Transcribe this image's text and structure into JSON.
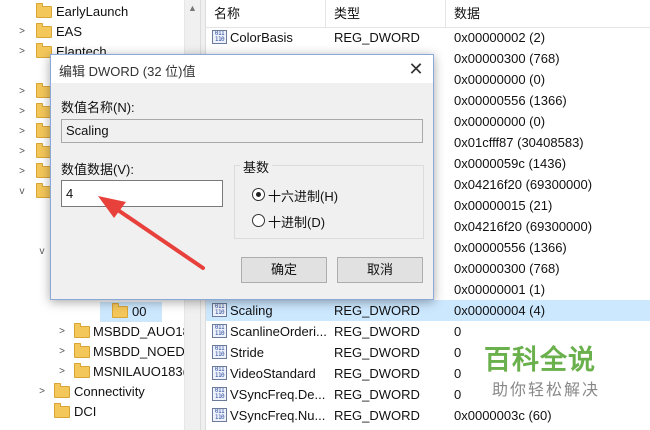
{
  "tree": {
    "items": [
      {
        "label": "EarlyLaunch"
      },
      {
        "label": "EAS"
      },
      {
        "label": "Elantech"
      },
      {
        "label": "00"
      },
      {
        "label": "MSBDD_AUO18"
      },
      {
        "label": "MSBDD_NOEDI"
      },
      {
        "label": "MSNILAUO183("
      },
      {
        "label": "Connectivity"
      },
      {
        "label": "DCI"
      }
    ]
  },
  "list": {
    "headers": {
      "name": "名称",
      "type": "类型",
      "data": "数据"
    },
    "rows": [
      {
        "name": "ColorBasis",
        "type": "REG_DWORD",
        "data": "0x00000002 (2)"
      },
      {
        "name": "",
        "type": "",
        "data": "0x00000300 (768)"
      },
      {
        "name": "",
        "type": "",
        "data": "0x00000000 (0)"
      },
      {
        "name": "",
        "type": "",
        "data": "0x00000556 (1366)"
      },
      {
        "name": "",
        "type": "",
        "data": "0x00000000 (0)"
      },
      {
        "name": "",
        "type": "",
        "data": "0x01cfff87 (30408583)"
      },
      {
        "name": "",
        "type": "",
        "data": "0x0000059c (1436)"
      },
      {
        "name": "",
        "type": "",
        "data": "0x04216f20 (69300000)"
      },
      {
        "name": "",
        "type": "",
        "data": "0x00000015 (21)"
      },
      {
        "name": "",
        "type": "",
        "data": "0x04216f20 (69300000)"
      },
      {
        "name": "",
        "type": "",
        "data": "0x00000556 (1366)"
      },
      {
        "name": "",
        "type": "",
        "data": "0x00000300 (768)"
      },
      {
        "name": "",
        "type": "",
        "data": "0x00000001 (1)"
      },
      {
        "name": "Scaling",
        "type": "REG_DWORD",
        "data": "0x00000004 (4)"
      },
      {
        "name": "ScanlineOrderi...",
        "type": "REG_DWORD",
        "data": "0"
      },
      {
        "name": "Stride",
        "type": "REG_DWORD",
        "data": "0"
      },
      {
        "name": "VideoStandard",
        "type": "REG_DWORD",
        "data": "0"
      },
      {
        "name": "VSyncFreq.De...",
        "type": "REG_DWORD",
        "data": "0"
      },
      {
        "name": "VSyncFreq.Nu...",
        "type": "REG_DWORD",
        "data": "0x0000003c (60)"
      }
    ],
    "reg_icon_text": "011\n110"
  },
  "dialog": {
    "title": "编辑 DWORD (32 位)值",
    "close_glyph": "✕",
    "name_label": "数值名称(N):",
    "name_value": "Scaling",
    "data_label": "数值数据(V):",
    "data_value": "4",
    "base_label": "基数",
    "hex_label": "十六进制(H)",
    "dec_label": "十进制(D)",
    "base_selected": "hex",
    "ok_label": "确定",
    "cancel_label": "取消"
  },
  "watermark": {
    "main": "百科全说",
    "sub": "助你轻松解决"
  },
  "colors": {
    "selection": "#cce8ff",
    "annotation_arrow": "#e8413c",
    "watermark_green": "#6ab04c"
  }
}
